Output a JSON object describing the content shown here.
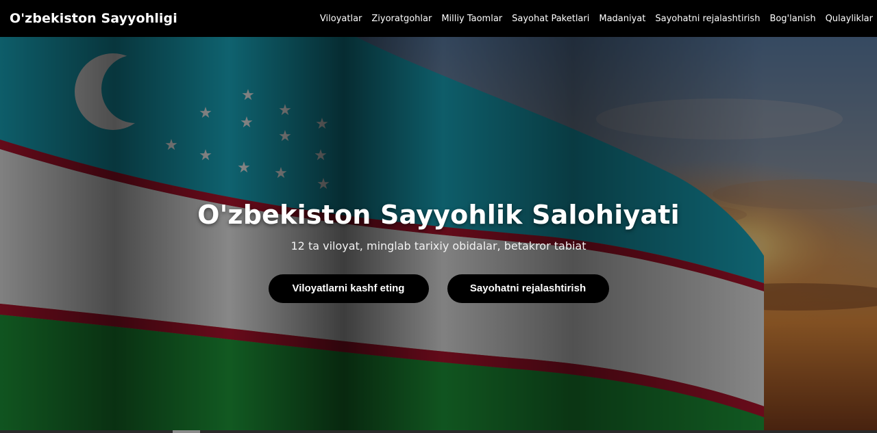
{
  "navbar": {
    "brand": "O'zbekiston Sayyohligi",
    "links": [
      {
        "label": "Viloyatlar"
      },
      {
        "label": "Ziyoratgohlar"
      },
      {
        "label": "Milliy Taomlar"
      },
      {
        "label": "Sayohat Paketlari"
      },
      {
        "label": "Madaniyat"
      },
      {
        "label": "Sayohatni rejalashtirish"
      },
      {
        "label": "Bog'lanish"
      },
      {
        "label": "Qulayliklar"
      }
    ]
  },
  "hero": {
    "title": "O'zbekiston Sayyohlik Salohiyati",
    "subtitle": "12 ta viloyat, minglab tarixiy obidalar, betakror tabiat",
    "background_image": "uzbekistan-flag-sunset",
    "buttons": {
      "explore_label": "Viloyatlarni kashf eting",
      "plan_label": "Sayohatni rejalashtirish"
    }
  },
  "colors": {
    "navbar_bg": "#000000",
    "button_bg": "#000000",
    "flag_blue": "#1eb5c8",
    "flag_red": "#c8102e",
    "flag_green": "#1eb53a",
    "sunset": "#f2a33a"
  }
}
